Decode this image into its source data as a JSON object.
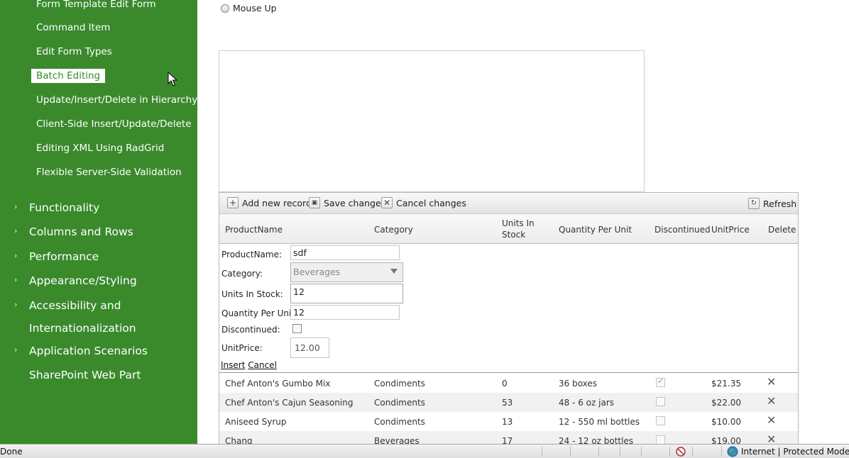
{
  "sidebar": {
    "sub_items": [
      {
        "label": "Form Template Edit Form",
        "selected": false
      },
      {
        "label": "Command Item",
        "selected": false
      },
      {
        "label": "Edit Form Types",
        "selected": false
      },
      {
        "label": "Batch Editing",
        "selected": true
      },
      {
        "label": "Update/Insert/Delete in Hierarchy",
        "selected": false
      },
      {
        "label": "Client-Side Insert/Update/Delete",
        "selected": false
      },
      {
        "label": "Editing XML Using RadGrid",
        "selected": false
      },
      {
        "label": "Flexible Server-Side Validation",
        "selected": false
      }
    ],
    "main_items": [
      {
        "label": "Functionality",
        "expandable": true
      },
      {
        "label": "Columns and Rows",
        "expandable": true
      },
      {
        "label": "Performance",
        "expandable": true
      },
      {
        "label": "Appearance/Styling",
        "expandable": true
      },
      {
        "label": "Accessibility and",
        "label2": "Internationalization",
        "expandable": true
      },
      {
        "label": "Application Scenarios",
        "expandable": true
      },
      {
        "label": "SharePoint Web Part",
        "expandable": false
      }
    ]
  },
  "option": {
    "label": "Mouse Up"
  },
  "grid": {
    "commands": {
      "add": "Add new record",
      "save": "Save changes",
      "cancel": "Cancel changes",
      "refresh": "Refresh"
    },
    "columns": {
      "product": "ProductName",
      "category": "Category",
      "units_line1": "Units In",
      "units_line2": "Stock",
      "qty": "Quantity Per Unit",
      "disc": "Discontinued",
      "price": "UnitPrice",
      "delete": "Delete"
    },
    "edit_form": {
      "product_label": "ProductName:",
      "product_value": "sdf",
      "category_label": "Category:",
      "category_value": "Beverages",
      "units_label": "Units In Stock:",
      "units_value": "12",
      "qty_label": "Quantity Per Unit:",
      "qty_value": "12",
      "disc_label": "Discontinued:",
      "price_label": "UnitPrice:",
      "price_value": "12.00",
      "insert_link": "Insert",
      "cancel_link": "Cancel"
    },
    "rows": [
      {
        "product": "Chef Anton's Gumbo Mix",
        "category": "Condiments",
        "units": "0",
        "qty": "36 boxes",
        "discontinued": true,
        "price": "$21.35"
      },
      {
        "product": "Chef Anton's Cajun Seasoning",
        "category": "Condiments",
        "units": "53",
        "qty": "48 - 6 oz jars",
        "discontinued": false,
        "price": "$22.00"
      },
      {
        "product": "Aniseed Syrup",
        "category": "Condiments",
        "units": "13",
        "qty": "12 - 550 ml bottles",
        "discontinued": false,
        "price": "$10.00"
      },
      {
        "product": "Chang",
        "category": "Beverages",
        "units": "17",
        "qty": "24 - 12 oz bottles",
        "discontinued": false,
        "price": "$19.00"
      }
    ]
  },
  "statusbar": {
    "left": "Done",
    "zone": "Internet | Protected Mode: O"
  },
  "colors": {
    "sidebar_bg": "#3a8a2c"
  }
}
